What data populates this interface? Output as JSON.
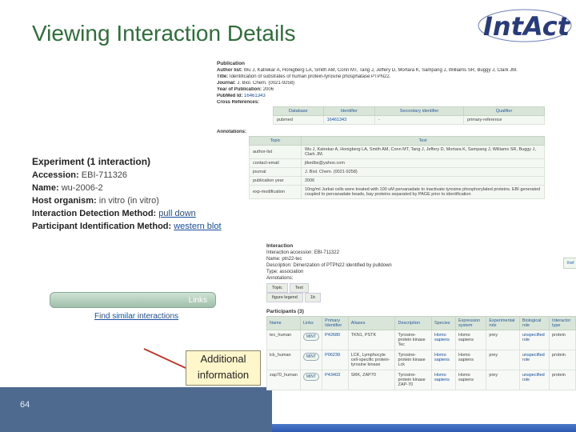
{
  "slide": {
    "title": "Viewing Interaction Details",
    "page_number": "64",
    "logo_text": "IntAct"
  },
  "experiment": {
    "title": "Experiment (1 interaction)",
    "accession_label": "Accession:",
    "accession_value": "EBI-711326",
    "name_label": "Name:",
    "name_value": "wu-2006-2",
    "host_label": "Host organism:",
    "host_value": "in vitro (in vitro)",
    "detection_label": "Interaction Detection Method:",
    "detection_value": "pull down",
    "participant_label": "Participant Identification Method:",
    "participant_value": "western blot",
    "links_button": "Links",
    "similar_link": "Find similar interactions"
  },
  "callout": {
    "line1": "Additional",
    "line2": "information"
  },
  "publication": {
    "heading": "Publication",
    "author_list_label": "Author list:",
    "author_list": "Wu J, Katrekar A, Honigberg LA, Smith AM, Conn MT, Tang J, Jeffery D, Mortara K, Sampang J, Williams SR, Buggy J, Clark JM.",
    "title_label": "Title:",
    "title": "Identification of substrates of human protein-tyrosine phosphatase PTPN22.",
    "journal_label": "Journal:",
    "journal": "J. Biol. Chem. (0021-9258)",
    "year_label": "Year of Publication:",
    "year": "2006",
    "pubmed_label": "PubMed Id:",
    "pubmed": "16461343",
    "xref_label": "Cross References:",
    "xref_headers": [
      "Database",
      "Identifier",
      "Secondary identifier",
      "Qualifier"
    ],
    "xref_row": [
      "pubmed",
      "16461343",
      "-",
      "primary-reference"
    ],
    "annotations_label": "Annotations:",
    "annot_headers": [
      "Topic",
      "Text"
    ],
    "annot_rows": [
      [
        "author-list",
        "Wu J, Katrekar A, Honigberg LA, Smith AM, Conn MT, Tang J, Jeffery D, Mortara K, Sampang J, Williams SR, Buggy J, Clark JM."
      ],
      [
        "contact-email",
        "jtkedbs@yahoo.com"
      ],
      [
        "journal",
        "J. Biol. Chem. (0021-9258)"
      ],
      [
        "publication year",
        "2006"
      ],
      [
        "exp-modification",
        "10ng/ml Jurkat cells were treated with 100 uM pervanadate to inactivate tyrosine phosphorylated proteins. EBI generated coupled to pervanadate beads, bay proteins separated by PAGE prior to identification"
      ]
    ]
  },
  "interaction": {
    "heading": "Interaction",
    "accession": "Interaction accession: EBI-711322",
    "name": "Name: ptn22-tec",
    "description": "Description: Dimerization of PTPN22 identified by pulldown",
    "type": "Type: association",
    "annotations_label": "Annotations:",
    "tabs": [
      "Topic",
      "Text"
    ],
    "tab_values": [
      "figure legend",
      "1b"
    ],
    "side_button": "Xref",
    "participants_title": "Participants (3)",
    "participants_headers": [
      "Name",
      "Links",
      "Primary Identifier",
      "Aliases",
      "Description",
      "Species",
      "Expression system",
      "Experimental role",
      "Biological role",
      "Interactor type"
    ],
    "participants_rows": [
      [
        "tec_human",
        "MINT",
        "P42680",
        "TKN1, PSTK",
        "Tyrosine-protein kinase Tec",
        "Homo sapiens",
        "Homo sapiens",
        "prey",
        "unspecified role",
        "protein"
      ],
      [
        "lck_human",
        "MINT",
        "P06239",
        "LCK, Lymphocyte cell-specific protein-tyrosine kinase",
        "Tyrosine-protein kinase Lck",
        "Homo sapiens",
        "Homo sapiens",
        "prey",
        "unspecified role",
        "protein"
      ],
      [
        "zap70_human",
        "MINT",
        "P43403",
        "SRK, ZAP70",
        "Tyrosine-protein kinase ZAP-70",
        "Homo sapiens",
        "Homo sapiens",
        "prey",
        "unspecified role",
        "protein"
      ]
    ]
  },
  "colors": {
    "title_green": "#2f6e3b",
    "logo_blue": "#2a3b7c",
    "link_blue": "#1a4fa0",
    "bar_blue": "#4e6b8f"
  }
}
